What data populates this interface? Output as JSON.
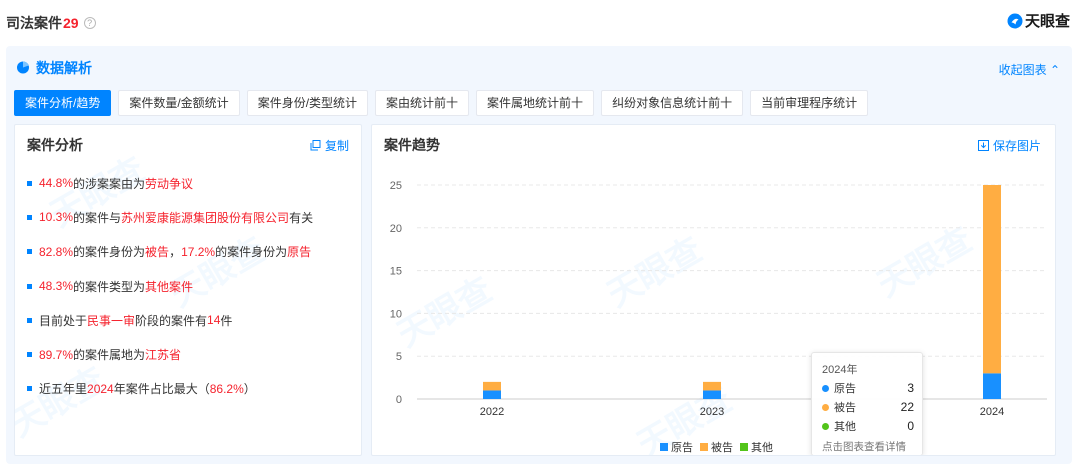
{
  "header": {
    "title": "司法案件",
    "count": "29",
    "help_icon": "question-circle-icon",
    "brand_name": "天眼查",
    "brand_logo": "tianyancha-logo"
  },
  "panel": {
    "title": "数据解析",
    "title_icon": "pie-chart-icon",
    "collapse_label": "收起图表",
    "collapse_icon": "chevron-up-icon"
  },
  "tabs": [
    {
      "label": "案件分析/趋势",
      "active": true
    },
    {
      "label": "案件数量/金额统计",
      "active": false
    },
    {
      "label": "案件身份/类型统计",
      "active": false
    },
    {
      "label": "案由统计前十",
      "active": false
    },
    {
      "label": "案件属地统计前十",
      "active": false
    },
    {
      "label": "纠纷对象信息统计前十",
      "active": false
    },
    {
      "label": "当前审理程序统计",
      "active": false
    }
  ],
  "analysis": {
    "title": "案件分析",
    "copy_label": "复制",
    "copy_icon": "copy-icon",
    "items": [
      [
        {
          "t": "44.8%",
          "hl": true
        },
        {
          "t": "的涉案案由为",
          "hl": false
        },
        {
          "t": "劳动争议",
          "hl": true
        }
      ],
      [
        {
          "t": "10.3%",
          "hl": true
        },
        {
          "t": "的案件与",
          "hl": false
        },
        {
          "t": "苏州爱康能源集团股份有限公司",
          "hl": true
        },
        {
          "t": "有关",
          "hl": false
        }
      ],
      [
        {
          "t": "82.8%",
          "hl": true
        },
        {
          "t": "的案件身份为",
          "hl": false
        },
        {
          "t": "被告",
          "hl": true
        },
        {
          "t": "，",
          "hl": false
        },
        {
          "t": "17.2%",
          "hl": true
        },
        {
          "t": "的案件身份为",
          "hl": false
        },
        {
          "t": "原告",
          "hl": true
        }
      ],
      [
        {
          "t": "48.3%",
          "hl": true
        },
        {
          "t": "的案件类型为",
          "hl": false
        },
        {
          "t": "其他案件",
          "hl": true
        }
      ],
      [
        {
          "t": "目前处于",
          "hl": false
        },
        {
          "t": "民事一审",
          "hl": true
        },
        {
          "t": "阶段的案件有",
          "hl": false
        },
        {
          "t": "14",
          "hl": true
        },
        {
          "t": "件",
          "hl": false
        }
      ],
      [
        {
          "t": "89.7%",
          "hl": true
        },
        {
          "t": "的案件属地为",
          "hl": false
        },
        {
          "t": "江苏省",
          "hl": true
        }
      ],
      [
        {
          "t": "近五年里",
          "hl": false
        },
        {
          "t": "2024",
          "hl": true
        },
        {
          "t": "年案件占比最大（",
          "hl": false
        },
        {
          "t": "86.2%",
          "hl": true
        },
        {
          "t": "）",
          "hl": false
        }
      ]
    ]
  },
  "trend": {
    "title": "案件趋势",
    "save_label": "保存图片",
    "save_icon": "download-icon",
    "watermark": "天眼查",
    "tooltip": {
      "title": "2024年",
      "rows": [
        {
          "name": "原告",
          "value": "3",
          "color": "#1890ff"
        },
        {
          "name": "被告",
          "value": "22",
          "color": "#ffad42"
        },
        {
          "name": "其他",
          "value": "0",
          "color": "#52c41a"
        }
      ],
      "footer": "点击图表查看详情"
    }
  },
  "chart_data": {
    "type": "bar",
    "stacked": true,
    "categories": [
      "2022",
      "2023",
      "2024"
    ],
    "series": [
      {
        "name": "原告",
        "color": "#1890ff",
        "values": [
          1,
          1,
          3
        ]
      },
      {
        "name": "被告",
        "color": "#ffad42",
        "values": [
          1,
          1,
          22
        ]
      },
      {
        "name": "其他",
        "color": "#52c41a",
        "values": [
          0,
          0,
          0
        ]
      }
    ],
    "ylim": [
      0,
      25
    ],
    "yticks": [
      0,
      5,
      10,
      15,
      20,
      25
    ],
    "grid": true,
    "legend_position": "bottom"
  }
}
